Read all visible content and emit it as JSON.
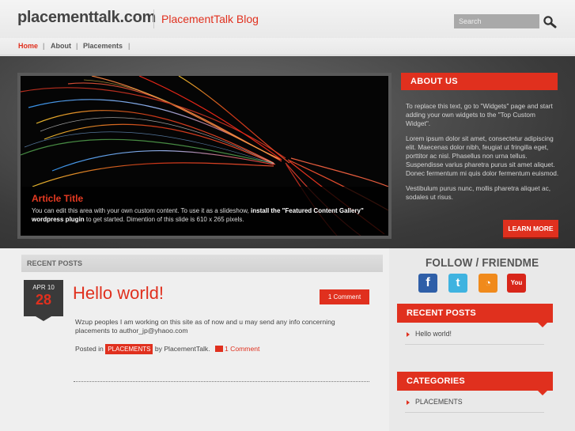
{
  "header": {
    "site_name": "placementtalk.com",
    "blog_title": "PlacementTalk Blog",
    "search_placeholder": "Search"
  },
  "nav": {
    "items": [
      {
        "label": "Home",
        "active": true
      },
      {
        "label": "About",
        "active": false
      },
      {
        "label": "Placements",
        "active": false
      }
    ],
    "separator": "|"
  },
  "featured": {
    "title": "Article Title",
    "body_before": "You can edit this area with your own custom content. To use it as a slideshow, ",
    "body_bold": "install the \"Featured Content Gallery\" wordpress plugin",
    "body_after": " to get started. Dimention of this slide is 610 x 265 pixels."
  },
  "about": {
    "heading": "ABOUT US",
    "paragraphs": [
      "To replace this text, go to \"Widgets\" page and start adding your own widgets to the \"Top Custom Widget\".",
      "Lorem ipsum dolor sit amet, consectetur adipiscing elit. Maecenas dolor nibh, feugiat ut fringilla eget, porttitor ac nisl. Phasellus non urna tellus. Suspendisse varius pharetra purus sit amet aliquet. Donec fermentum mi quis dolor fermentum euismod.",
      "Vestibulum purus nunc, mollis pharetra aliquet ac, sodales ut risus."
    ],
    "button_label": "LEARN MORE"
  },
  "main": {
    "section_heading": "RECENT POSTS",
    "post": {
      "date_month": "APR 10",
      "date_day": "28",
      "title": "Hello world!",
      "comments_button": "1 Comment",
      "body": "Wzup peoples I am working on this site as of now and u may send any info concerning placements to author_jp@yhaoo.com",
      "meta_posted_in": "Posted in",
      "meta_category": "PLACEMENTS",
      "meta_by": "by PlacementTalk.",
      "meta_comments": "1 Comment"
    }
  },
  "sidebar": {
    "follow_heading": "FOLLOW / FRIENDME",
    "social": [
      {
        "icon": "facebook-icon",
        "glyph": "f",
        "color": "#2f5fa8"
      },
      {
        "icon": "twitter-icon",
        "glyph": "t",
        "color": "#3fb3e0"
      },
      {
        "icon": "rss-icon",
        "glyph": "◔",
        "color": "#f08a1c"
      },
      {
        "icon": "youtube-icon",
        "glyph": "You",
        "color": "#d8261a"
      }
    ],
    "recent_posts": {
      "heading": "RECENT POSTS",
      "items": [
        "Hello world!"
      ]
    },
    "categories": {
      "heading": "CATEGORIES",
      "items": [
        "PLACEMENTS"
      ]
    }
  },
  "colors": {
    "accent": "#e0301e",
    "dark_band": "#3a3a3a"
  }
}
